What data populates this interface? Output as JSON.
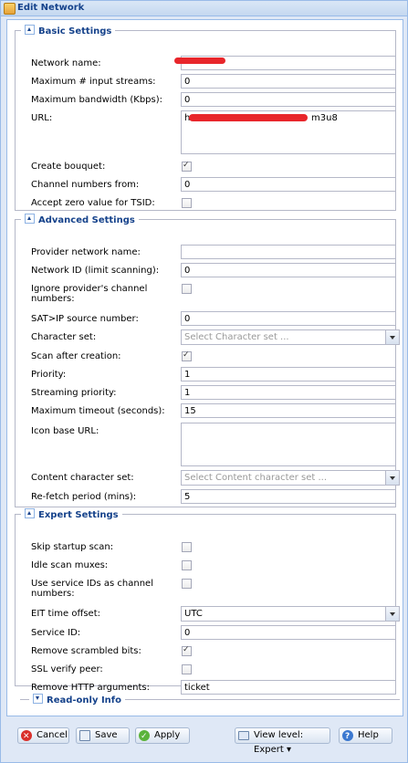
{
  "window": {
    "title": "Edit Network"
  },
  "sections": {
    "basic": {
      "title": "Basic Settings"
    },
    "advanced": {
      "title": "Advanced Settings"
    },
    "expert": {
      "title": "Expert Settings"
    },
    "readonly": {
      "title": "Read-only Info"
    }
  },
  "basic": {
    "network_name": {
      "label": "Network name:",
      "value": ""
    },
    "max_input_streams": {
      "label": "Maximum # input streams:",
      "value": "0"
    },
    "max_bandwidth": {
      "label": "Maximum bandwidth (Kbps):",
      "value": "0"
    },
    "url": {
      "label": "URL:",
      "value_start": "h",
      "value_end": "m3u8"
    },
    "create_bouquet": {
      "label": "Create bouquet:",
      "checked": true
    },
    "channel_numbers_from": {
      "label": "Channel numbers from:",
      "value": "0"
    },
    "accept_zero_tsid": {
      "label": "Accept zero value for TSID:",
      "checked": false
    }
  },
  "advanced": {
    "provider_network_name": {
      "label": "Provider network name:",
      "value": ""
    },
    "network_id": {
      "label": "Network ID (limit scanning):",
      "value": "0"
    },
    "ignore_channel_numbers": {
      "label": "Ignore provider's channel numbers:",
      "checked": false
    },
    "satip_source": {
      "label": "SAT>IP source number:",
      "value": "0"
    },
    "character_set": {
      "label": "Character set:",
      "placeholder": "Select Character set ..."
    },
    "scan_after_creation": {
      "label": "Scan after creation:",
      "checked": true
    },
    "priority": {
      "label": "Priority:",
      "value": "1"
    },
    "streaming_priority": {
      "label": "Streaming priority:",
      "value": "1"
    },
    "max_timeout": {
      "label": "Maximum timeout (seconds):",
      "value": "15"
    },
    "icon_base_url": {
      "label": "Icon base URL:",
      "value": ""
    },
    "content_charset": {
      "label": "Content character set:",
      "placeholder": "Select Content character set ..."
    },
    "refetch_period": {
      "label": "Re-fetch period (mins):",
      "value": "5"
    }
  },
  "expert": {
    "skip_startup_scan": {
      "label": "Skip startup scan:",
      "checked": false
    },
    "idle_scan_muxes": {
      "label": "Idle scan muxes:",
      "checked": false
    },
    "use_service_ids": {
      "label": "Use service IDs as channel numbers:",
      "checked": false
    },
    "eit_time_offset": {
      "label": "EIT time offset:",
      "value": "UTC"
    },
    "service_id": {
      "label": "Service ID:",
      "value": "0"
    },
    "remove_scrambled_bits": {
      "label": "Remove scrambled bits:",
      "checked": true
    },
    "ssl_verify_peer": {
      "label": "SSL verify peer:",
      "checked": false
    },
    "remove_http_args": {
      "label": "Remove HTTP arguments:",
      "value": "ticket"
    }
  },
  "buttons": {
    "cancel": "Cancel",
    "save": "Save",
    "apply": "Apply",
    "view_level": "View level: Expert ▾",
    "help": "Help"
  },
  "colors": {
    "accent": "#15428b",
    "border": "#99bbe8",
    "background": "#dfe8f6",
    "redaction": "#e8262b"
  }
}
